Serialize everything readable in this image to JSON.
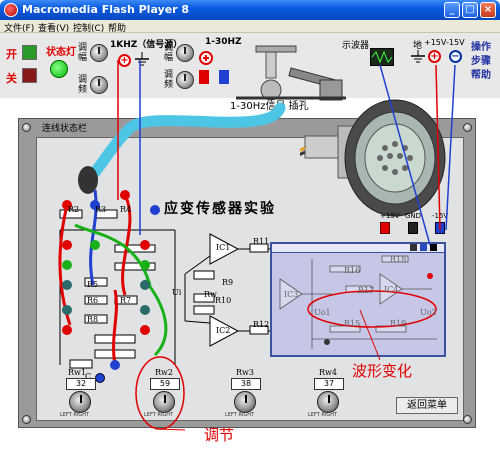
{
  "window": {
    "title": "Macromedia Flash Player 8",
    "minimize": "_",
    "maximize": "□",
    "close": "×"
  },
  "menu": [
    "文件(F)",
    "查看(V)",
    "控制(C)",
    "帮助"
  ],
  "toolbar": {
    "on_label": "开",
    "off_label": "关",
    "status_light_label": "状态灯",
    "amp_label_1": "调\n幅",
    "freq_label_1": "调\n频",
    "signal_source_label": "1KHZ（信号源）",
    "range_label": "1-30HZ",
    "amp_label_2": "调\n幅",
    "freq_label_2": "调\n频",
    "socket_label": "1-30Hz信号 插孔",
    "oscilloscope_label": "示波器",
    "ground_label": "地",
    "plus15_label": "+15V",
    "minus15_label": "-15V",
    "help_items": [
      "操作",
      "步骤",
      "帮助"
    ]
  },
  "board": {
    "status_bar_label": "连线状态栏",
    "title": "应变传感器实验",
    "return_button": "返回菜单",
    "power_labels": [
      "+15V",
      "GND",
      "-15V"
    ],
    "component_labels": [
      "R2",
      "R3",
      "R4",
      "R5",
      "R6",
      "R7",
      "R8",
      "R9",
      "R10",
      "R11",
      "R12",
      "Rw1",
      "Rw2",
      "Rw3",
      "Rw4",
      "IC1",
      "IC2",
      "Ui",
      "Rw",
      "C"
    ],
    "pots": [
      {
        "name": "Rw1",
        "value": "32"
      },
      {
        "name": "Rw2",
        "value": "59"
      },
      {
        "name": "Rw3",
        "value": "38"
      },
      {
        "name": "Rw4",
        "value": "37"
      }
    ],
    "pot_scale": "LEFT  RIGHT"
  },
  "scope": {
    "labels": [
      "R16",
      "R17",
      "R18",
      "R15",
      "R19",
      "IC3",
      "IC4",
      "Uo1",
      "Uo2"
    ]
  },
  "annotations": {
    "waveform_change": "波形变化",
    "adjust": "调节"
  },
  "colors": {
    "red_wire": "#e00000",
    "green_wire": "#19b119",
    "blue_wire": "#2040d0",
    "cable": "#4dc6e6",
    "annotation": "#e00000"
  }
}
